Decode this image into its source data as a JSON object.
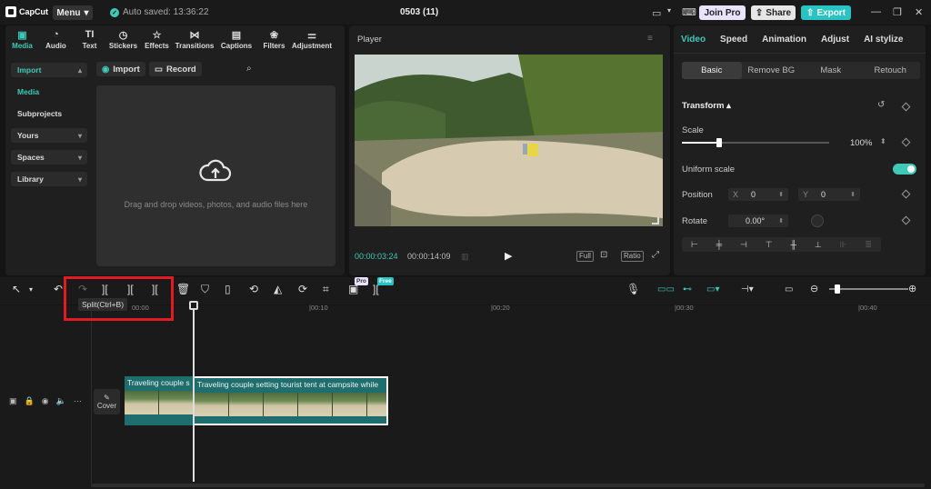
{
  "app": {
    "logo": "CapCut",
    "menu": "Menu",
    "autosave": "Auto saved: 13:36:22",
    "project_title": "0503 (11)",
    "join_pro": "Join Pro",
    "share": "Share",
    "export": "Export"
  },
  "toolbar_tabs": [
    "Media",
    "Audio",
    "Text",
    "Stickers",
    "Effects",
    "Transitions",
    "Captions",
    "Filters",
    "Adjustment"
  ],
  "sidebar": {
    "items": [
      "Import",
      "Media",
      "Subprojects",
      "Yours",
      "Spaces",
      "Library"
    ]
  },
  "media": {
    "import": "Import",
    "record": "Record",
    "drop_text": "Drag and drop videos, photos, and audio files here"
  },
  "player": {
    "title": "Player",
    "current_time": "00:00:03:24",
    "total_time": "00:00:14:09",
    "full": "Full",
    "ratio": "Ratio"
  },
  "properties": {
    "tabs": [
      "Video",
      "Speed",
      "Animation",
      "Adjust",
      "AI stylize"
    ],
    "sub_tabs": [
      "Basic",
      "Remove BG",
      "Mask",
      "Retouch"
    ],
    "transform": "Transform",
    "scale_label": "Scale",
    "scale_value": "100%",
    "scale_level": 0.25,
    "uniform_scale": "Uniform scale",
    "position_label": "Position",
    "pos_x_label": "X",
    "pos_x": "0",
    "pos_y_label": "Y",
    "pos_y": "0",
    "rotate_label": "Rotate",
    "rotate_value": "0.00°"
  },
  "timeline": {
    "tooltip": "Split(Ctrl+B)",
    "pro_badge": "Pro",
    "free_badge": "Free",
    "ruler": [
      "00:00",
      "|00:10",
      "|00:20",
      "|00:30",
      "|00:40"
    ],
    "clip1_label": "Traveling couple s",
    "clip2_label": "Traveling couple setting tourist tent at campsite while",
    "cover": "Cover"
  },
  "colors": {
    "accent": "#3ec9b8",
    "highlight": "#e21b23",
    "export": "#28c4c4",
    "clip": "#1f6e6e"
  }
}
